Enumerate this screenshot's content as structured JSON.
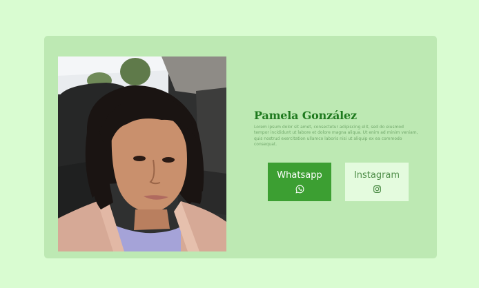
{
  "profile": {
    "name": "Pamela González",
    "bio": "Lorem ipsum dolor sit amet, consectetur adipiscing elit, sed do eiusmod tempor incididunt ut labore et dolore magna aliqua. Ut enim ad minim veniam, quis nostrud exercitation ullamco laboris nisi ut aliquip ex ea commodo consequat."
  },
  "buttons": {
    "whatsapp": {
      "label": "Whatsapp",
      "icon": "whatsapp-icon"
    },
    "instagram": {
      "label": "Instagram",
      "icon": "instagram-icon"
    }
  },
  "colors": {
    "page_background": "#d9fcd1",
    "card_background": "#bde9b3",
    "name_color": "#1f7a1f",
    "whatsapp_button": "#3c9f32",
    "instagram_button": "#e4fbde"
  }
}
